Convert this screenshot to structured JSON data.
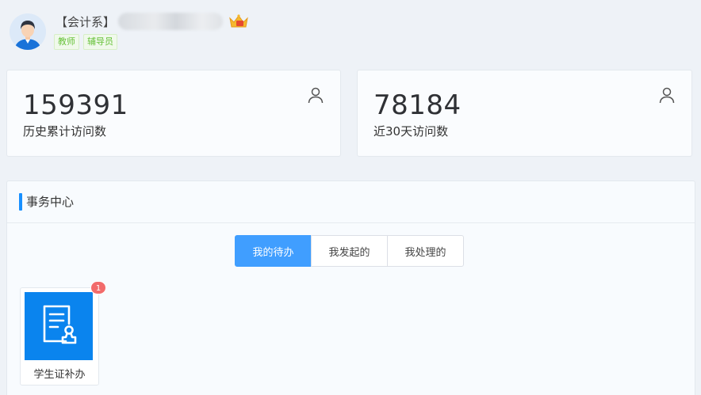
{
  "header": {
    "department": "【会计系】",
    "tags": [
      "教师",
      "辅导员"
    ]
  },
  "stats": [
    {
      "value": "159391",
      "label": "历史累计访问数"
    },
    {
      "value": "78184",
      "label": "近30天访问数"
    }
  ],
  "affairs": {
    "title": "事务中心",
    "tabs": [
      "我的待办",
      "我发起的",
      "我处理的"
    ],
    "active_tab": "我的待办",
    "apps": [
      {
        "label": "学生证补办",
        "badge": "1"
      }
    ]
  },
  "colors": {
    "accent": "#409eff",
    "app_icon_bg": "#0a84ee",
    "tag_green": "#67c23a",
    "badge_red": "#f26b6b"
  },
  "icons": [
    "avatar",
    "crown-icon",
    "user-icon",
    "certificate-icon"
  ]
}
